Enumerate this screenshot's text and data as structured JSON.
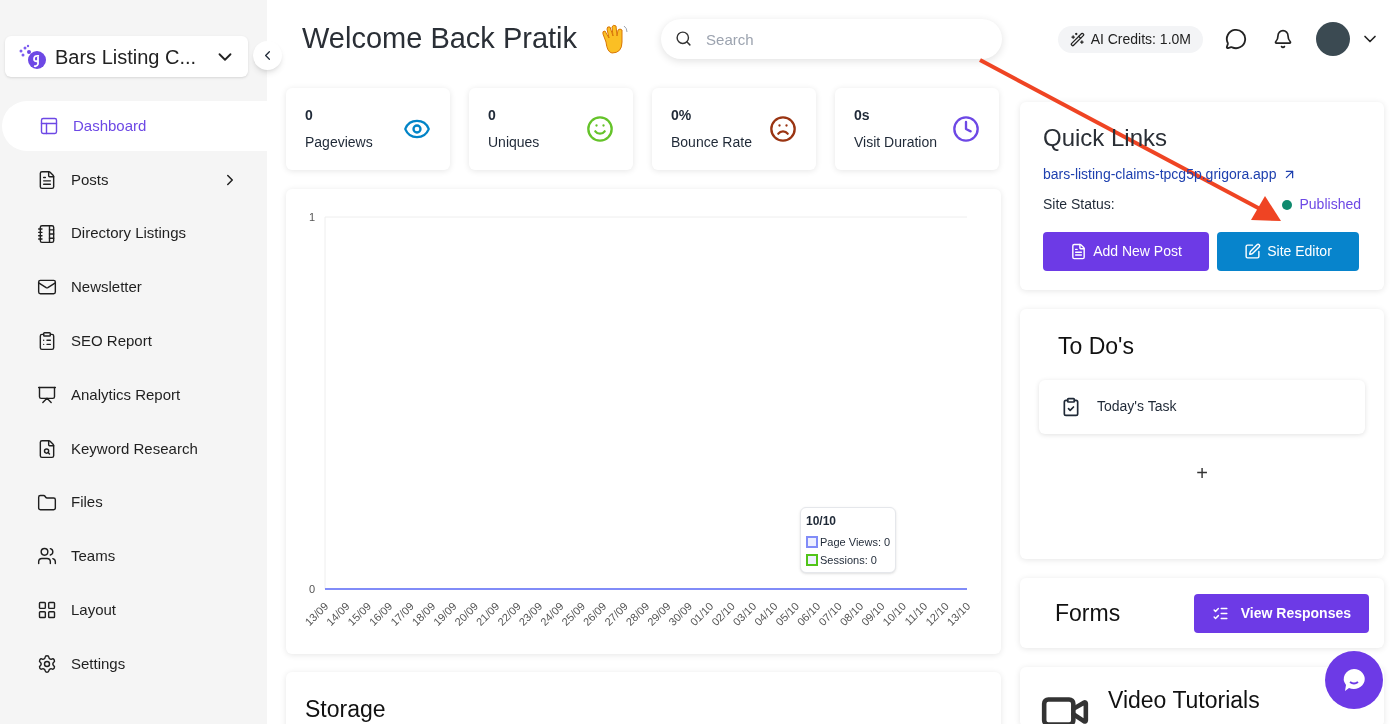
{
  "sidebar": {
    "brand": "Bars Listing C...",
    "items": [
      {
        "label": "Dashboard",
        "kind": "dashboard",
        "selected": true,
        "expandable": false
      },
      {
        "label": "Posts",
        "kind": "posts",
        "selected": false,
        "expandable": true
      },
      {
        "label": "Directory Listings",
        "kind": "directory",
        "selected": false,
        "expandable": false
      },
      {
        "label": "Newsletter",
        "kind": "newsletter",
        "selected": false,
        "expandable": false
      },
      {
        "label": "SEO Report",
        "kind": "seo",
        "selected": false,
        "expandable": false
      },
      {
        "label": "Analytics Report",
        "kind": "analytics",
        "selected": false,
        "expandable": false
      },
      {
        "label": "Keyword Research",
        "kind": "keyword",
        "selected": false,
        "expandable": false
      },
      {
        "label": "Files",
        "kind": "files",
        "selected": false,
        "expandable": false
      },
      {
        "label": "Teams",
        "kind": "teams",
        "selected": false,
        "expandable": false
      },
      {
        "label": "Layout",
        "kind": "layout",
        "selected": false,
        "expandable": false
      },
      {
        "label": "Settings",
        "kind": "settings",
        "selected": false,
        "expandable": false
      }
    ]
  },
  "header": {
    "title": "Welcome Back Pratik",
    "search": {
      "placeholder": "Search"
    },
    "credits": "AI Credits: 1.0M"
  },
  "stats": [
    {
      "value": "0",
      "label": "Pageviews",
      "kind": "eye"
    },
    {
      "value": "0",
      "label": "Uniques",
      "kind": "smile"
    },
    {
      "value": "0%",
      "label": "Bounce Rate",
      "kind": "frown"
    },
    {
      "value": "0s",
      "label": "Visit Duration",
      "kind": "clock"
    }
  ],
  "traffic": {
    "chart_data": {
      "type": "line",
      "categories": [
        "13/09",
        "14/09",
        "15/09",
        "16/09",
        "17/09",
        "18/09",
        "19/09",
        "20/09",
        "21/09",
        "22/09",
        "23/09",
        "24/09",
        "25/09",
        "26/09",
        "27/09",
        "28/09",
        "29/09",
        "30/09",
        "01/10",
        "02/10",
        "03/10",
        "04/10",
        "05/10",
        "06/10",
        "07/10",
        "08/10",
        "09/10",
        "10/10",
        "11/10",
        "12/10",
        "13/10"
      ],
      "ylim": [
        0,
        1
      ],
      "yticks": [
        0,
        1
      ],
      "series": [
        {
          "color": "#818cf8",
          "values": [
            0,
            0,
            0,
            0,
            0,
            0,
            0,
            0,
            0,
            0,
            0,
            0,
            0,
            0,
            0,
            0,
            0,
            0,
            0,
            0,
            0,
            0,
            0,
            0,
            0,
            0,
            0,
            0,
            0,
            0,
            0
          ]
        }
      ]
    },
    "tooltip": {
      "title": "10/10",
      "rows": [
        {
          "label": "Page Views: 0",
          "color": "#818cf8"
        },
        {
          "label": "Sessions: 0",
          "color": "#52c41a"
        }
      ]
    }
  },
  "storage": {
    "title": "Storage"
  },
  "quick_links": {
    "title": "Quick Links",
    "url": "bars-listing-claims-tpcg5p.grigora.app",
    "status_label": "Site Status:",
    "status": "Published",
    "buttons": [
      {
        "label": "Add New Post",
        "kind": "post"
      },
      {
        "label": "Site Editor",
        "kind": "editor"
      }
    ]
  },
  "todos": {
    "title": "To Do's",
    "items": [
      "Today's Task"
    ],
    "add": "+"
  },
  "forms": {
    "title": "Forms",
    "button": "View Responses"
  },
  "video": {
    "title": "Video Tutorials"
  }
}
